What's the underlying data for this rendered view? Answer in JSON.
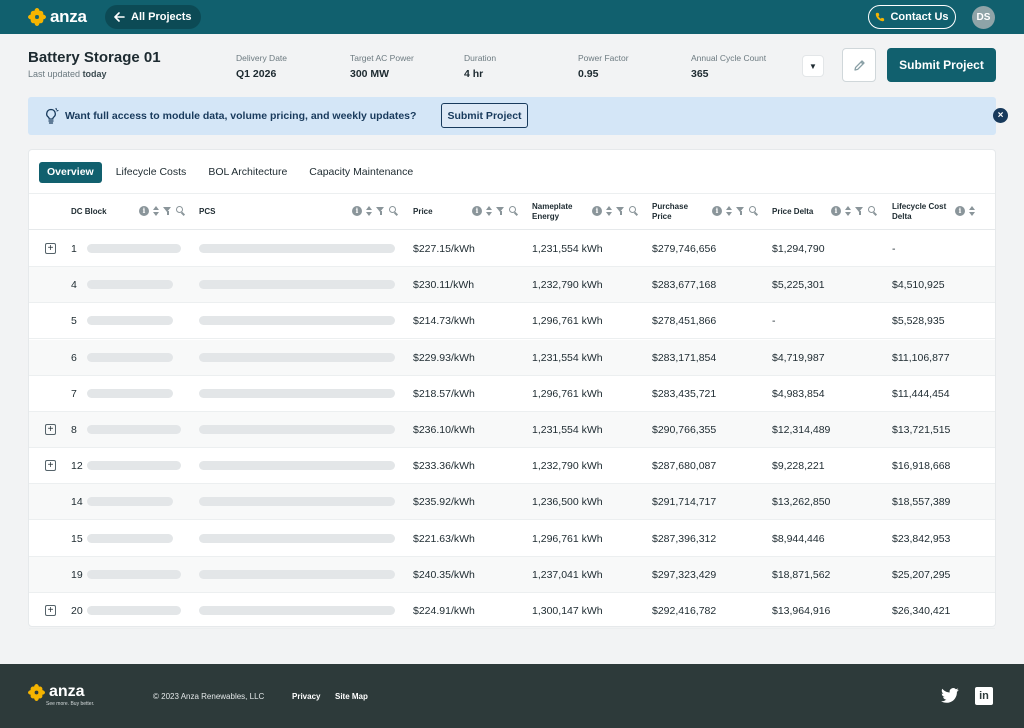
{
  "nav": {
    "logo_text": "anza",
    "back_label": "All Projects",
    "contact_label": "Contact Us",
    "avatar_initials": "DS",
    "brand_color": "#11606e",
    "logo_color": "#f5b400"
  },
  "project": {
    "title": "Battery Storage 01",
    "updated_prefix": "Last updated",
    "updated_value": "today",
    "stats": [
      {
        "label": "Delivery Date",
        "value": "Q1 2026"
      },
      {
        "label": "Target AC Power",
        "value": "300 MW"
      },
      {
        "label": "Duration",
        "value": "4 hr"
      },
      {
        "label": "Power Factor",
        "value": "0.95"
      },
      {
        "label": "Annual Cycle Count",
        "value": "365"
      }
    ],
    "submit_label": "Submit Project"
  },
  "banner": {
    "message": "Want full access to module data, volume pricing, and weekly updates?",
    "button_label": "Submit Project",
    "close_label": "×"
  },
  "tabs": [
    "Overview",
    "Lifecycle Costs",
    "BOL Architecture",
    "Capacity Maintenance"
  ],
  "table": {
    "headers": {
      "dc_block": "DC Block",
      "pcs": "PCS",
      "price": "Price",
      "nameplate_1": "Nameplate",
      "nameplate_2": "Energy",
      "purchase_1": "Purchase",
      "purchase_2": "Price",
      "price_delta": "Price Delta",
      "lifecycle_1": "Lifecycle Cost",
      "lifecycle_2": "Delta"
    },
    "rows": [
      {
        "expandable": true,
        "block": "1",
        "price": "$227.15/kWh",
        "energy": "1,231,554 kWh",
        "purchase": "$279,746,656",
        "delta": "$1,294,790",
        "lifecycle": "-"
      },
      {
        "expandable": false,
        "block": "4",
        "price": "$230.11/kWh",
        "energy": "1,232,790 kWh",
        "purchase": "$283,677,168",
        "delta": "$5,225,301",
        "lifecycle": "$4,510,925"
      },
      {
        "expandable": false,
        "block": "5",
        "price": "$214.73/kWh",
        "energy": "1,296,761 kWh",
        "purchase": "$278,451,866",
        "delta": "-",
        "lifecycle": "$5,528,935"
      },
      {
        "expandable": false,
        "block": "6",
        "price": "$229.93/kWh",
        "energy": "1,231,554 kWh",
        "purchase": "$283,171,854",
        "delta": "$4,719,987",
        "lifecycle": "$11,106,877"
      },
      {
        "expandable": false,
        "block": "7",
        "price": "$218.57/kWh",
        "energy": "1,296,761 kWh",
        "purchase": "$283,435,721",
        "delta": "$4,983,854",
        "lifecycle": "$11,444,454"
      },
      {
        "expandable": true,
        "block": "8",
        "price": "$236.10/kWh",
        "energy": "1,231,554 kWh",
        "purchase": "$290,766,355",
        "delta": "$12,314,489",
        "lifecycle": "$13,721,515"
      },
      {
        "expandable": true,
        "block": "12",
        "price": "$233.36/kWh",
        "energy": "1,232,790 kWh",
        "purchase": "$287,680,087",
        "delta": "$9,228,221",
        "lifecycle": "$16,918,668"
      },
      {
        "expandable": false,
        "block": "14",
        "price": "$235.92/kWh",
        "energy": "1,236,500 kWh",
        "purchase": "$291,714,717",
        "delta": "$13,262,850",
        "lifecycle": "$18,557,389"
      },
      {
        "expandable": false,
        "block": "15",
        "price": "$221.63/kWh",
        "energy": "1,296,761 kWh",
        "purchase": "$287,396,312",
        "delta": "$8,944,446",
        "lifecycle": "$23,842,953"
      },
      {
        "expandable": false,
        "block": "19",
        "price": "$240.35/kWh",
        "energy": "1,237,041 kWh",
        "purchase": "$297,323,429",
        "delta": "$18,871,562",
        "lifecycle": "$25,207,295"
      },
      {
        "expandable": true,
        "block": "20",
        "price": "$224.91/kWh",
        "energy": "1,300,147 kWh",
        "purchase": "$292,416,782",
        "delta": "$13,964,916",
        "lifecycle": "$26,340,421"
      }
    ]
  },
  "footer": {
    "logo_text": "anza",
    "tagline": "See more. Buy better.",
    "copyright": "© 2023 Anza Renewables, LLC",
    "links": [
      "Privacy",
      "Site Map"
    ],
    "social": [
      "twitter-icon",
      "linkedin-icon"
    ],
    "linkedin_label": "in"
  }
}
